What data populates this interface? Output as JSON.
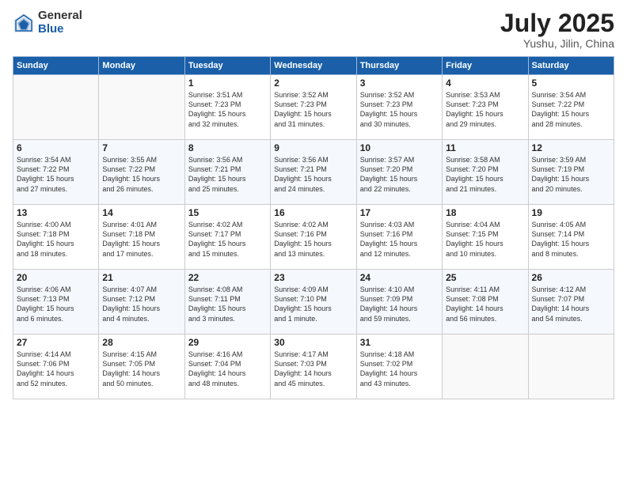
{
  "header": {
    "logo_general": "General",
    "logo_blue": "Blue",
    "title": "July 2025",
    "location": "Yushu, Jilin, China"
  },
  "days_of_week": [
    "Sunday",
    "Monday",
    "Tuesday",
    "Wednesday",
    "Thursday",
    "Friday",
    "Saturday"
  ],
  "weeks": [
    [
      {
        "day": "",
        "text": ""
      },
      {
        "day": "",
        "text": ""
      },
      {
        "day": "1",
        "text": "Sunrise: 3:51 AM\nSunset: 7:23 PM\nDaylight: 15 hours\nand 32 minutes."
      },
      {
        "day": "2",
        "text": "Sunrise: 3:52 AM\nSunset: 7:23 PM\nDaylight: 15 hours\nand 31 minutes."
      },
      {
        "day": "3",
        "text": "Sunrise: 3:52 AM\nSunset: 7:23 PM\nDaylight: 15 hours\nand 30 minutes."
      },
      {
        "day": "4",
        "text": "Sunrise: 3:53 AM\nSunset: 7:23 PM\nDaylight: 15 hours\nand 29 minutes."
      },
      {
        "day": "5",
        "text": "Sunrise: 3:54 AM\nSunset: 7:22 PM\nDaylight: 15 hours\nand 28 minutes."
      }
    ],
    [
      {
        "day": "6",
        "text": "Sunrise: 3:54 AM\nSunset: 7:22 PM\nDaylight: 15 hours\nand 27 minutes."
      },
      {
        "day": "7",
        "text": "Sunrise: 3:55 AM\nSunset: 7:22 PM\nDaylight: 15 hours\nand 26 minutes."
      },
      {
        "day": "8",
        "text": "Sunrise: 3:56 AM\nSunset: 7:21 PM\nDaylight: 15 hours\nand 25 minutes."
      },
      {
        "day": "9",
        "text": "Sunrise: 3:56 AM\nSunset: 7:21 PM\nDaylight: 15 hours\nand 24 minutes."
      },
      {
        "day": "10",
        "text": "Sunrise: 3:57 AM\nSunset: 7:20 PM\nDaylight: 15 hours\nand 22 minutes."
      },
      {
        "day": "11",
        "text": "Sunrise: 3:58 AM\nSunset: 7:20 PM\nDaylight: 15 hours\nand 21 minutes."
      },
      {
        "day": "12",
        "text": "Sunrise: 3:59 AM\nSunset: 7:19 PM\nDaylight: 15 hours\nand 20 minutes."
      }
    ],
    [
      {
        "day": "13",
        "text": "Sunrise: 4:00 AM\nSunset: 7:18 PM\nDaylight: 15 hours\nand 18 minutes."
      },
      {
        "day": "14",
        "text": "Sunrise: 4:01 AM\nSunset: 7:18 PM\nDaylight: 15 hours\nand 17 minutes."
      },
      {
        "day": "15",
        "text": "Sunrise: 4:02 AM\nSunset: 7:17 PM\nDaylight: 15 hours\nand 15 minutes."
      },
      {
        "day": "16",
        "text": "Sunrise: 4:02 AM\nSunset: 7:16 PM\nDaylight: 15 hours\nand 13 minutes."
      },
      {
        "day": "17",
        "text": "Sunrise: 4:03 AM\nSunset: 7:16 PM\nDaylight: 15 hours\nand 12 minutes."
      },
      {
        "day": "18",
        "text": "Sunrise: 4:04 AM\nSunset: 7:15 PM\nDaylight: 15 hours\nand 10 minutes."
      },
      {
        "day": "19",
        "text": "Sunrise: 4:05 AM\nSunset: 7:14 PM\nDaylight: 15 hours\nand 8 minutes."
      }
    ],
    [
      {
        "day": "20",
        "text": "Sunrise: 4:06 AM\nSunset: 7:13 PM\nDaylight: 15 hours\nand 6 minutes."
      },
      {
        "day": "21",
        "text": "Sunrise: 4:07 AM\nSunset: 7:12 PM\nDaylight: 15 hours\nand 4 minutes."
      },
      {
        "day": "22",
        "text": "Sunrise: 4:08 AM\nSunset: 7:11 PM\nDaylight: 15 hours\nand 3 minutes."
      },
      {
        "day": "23",
        "text": "Sunrise: 4:09 AM\nSunset: 7:10 PM\nDaylight: 15 hours\nand 1 minute."
      },
      {
        "day": "24",
        "text": "Sunrise: 4:10 AM\nSunset: 7:09 PM\nDaylight: 14 hours\nand 59 minutes."
      },
      {
        "day": "25",
        "text": "Sunrise: 4:11 AM\nSunset: 7:08 PM\nDaylight: 14 hours\nand 56 minutes."
      },
      {
        "day": "26",
        "text": "Sunrise: 4:12 AM\nSunset: 7:07 PM\nDaylight: 14 hours\nand 54 minutes."
      }
    ],
    [
      {
        "day": "27",
        "text": "Sunrise: 4:14 AM\nSunset: 7:06 PM\nDaylight: 14 hours\nand 52 minutes."
      },
      {
        "day": "28",
        "text": "Sunrise: 4:15 AM\nSunset: 7:05 PM\nDaylight: 14 hours\nand 50 minutes."
      },
      {
        "day": "29",
        "text": "Sunrise: 4:16 AM\nSunset: 7:04 PM\nDaylight: 14 hours\nand 48 minutes."
      },
      {
        "day": "30",
        "text": "Sunrise: 4:17 AM\nSunset: 7:03 PM\nDaylight: 14 hours\nand 45 minutes."
      },
      {
        "day": "31",
        "text": "Sunrise: 4:18 AM\nSunset: 7:02 PM\nDaylight: 14 hours\nand 43 minutes."
      },
      {
        "day": "",
        "text": ""
      },
      {
        "day": "",
        "text": ""
      }
    ]
  ]
}
